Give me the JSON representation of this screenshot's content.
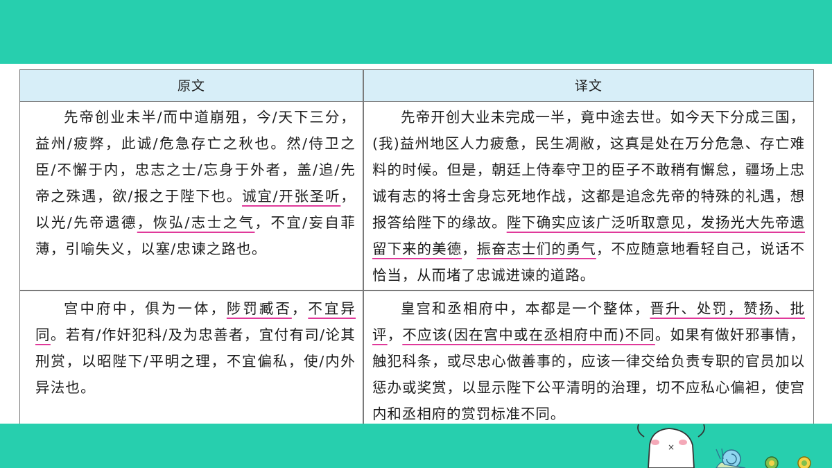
{
  "table": {
    "headers": [
      "原文",
      "译文"
    ],
    "rows": [
      {
        "original": [
          {
            "t": "先帝创业未半/而中道崩殂，今/天下三分，益州/疲弊，此诚/危急存亡之秋也。然/侍卫之臣/不懈于内，忠志之士/忘身于外者，盖/追/先帝之殊遇，欲/报之于陛下也。"
          },
          {
            "t": "诚宜/开张圣听",
            "hl": true
          },
          {
            "t": "，以光/先帝遗德",
            "hl": false
          },
          {
            "t": "，恢弘/志士之气",
            "hl": true
          },
          {
            "t": "，不宜/妄自菲薄，引喻失义，以塞/忠谏之路也。"
          }
        ],
        "translation": [
          {
            "t": "先帝开创大业未完成一半，竟中途去世。如今天下分成三国，(我)益州地区人力疲惫，民生凋敝，这真是处在万分危急、存亡难料的时候。但是，朝廷上侍奉守卫的臣子不敢稍有懈怠，疆场上忠诚有志的将士舍身忘死地作战，这都是追念先帝的特殊的礼遇，想报答给陛下的缘故。"
          },
          {
            "t": "陛下确实应该广泛听取意见",
            "hl": true
          },
          {
            "t": "，发扬光大先帝遗留下来的美德",
            "hl": true
          },
          {
            "t": "，"
          },
          {
            "t": "振奋志士们的勇气",
            "hl": true
          },
          {
            "t": "，不应随意地看轻自己，说话不恰当，从而堵了忠诚进谏的道路。"
          }
        ]
      },
      {
        "original": [
          {
            "t": "宫中府中，俱为一体，"
          },
          {
            "t": "陟罚臧否",
            "hl": true
          },
          {
            "t": "，"
          },
          {
            "t": "不宜异同",
            "hl": true
          },
          {
            "t": "。若有/作奸犯科/及为忠善者，宜付有司/论其刑赏，以昭陛下/平明之理，不宜偏私，使/内外异法也。"
          }
        ],
        "translation": [
          {
            "t": "皇宫和丞相府中，本都是一个整体，"
          },
          {
            "t": "晋升、处罚，赞扬、批评",
            "hl": true
          },
          {
            "t": "，"
          },
          {
            "t": "不应该(因在宫中或在丞相府中而)不同",
            "hl": true
          },
          {
            "t": "。如果有做奸邪事情，触犯科条，或尽忠心做善事的，应该一律交给负责专职的官员加以惩办或奖赏，以显示陛下公平清明的治理，切不应私心偏袒，使宫内和丞相府的赏罚标准不同。"
          }
        ]
      }
    ]
  },
  "colors": {
    "band": "#27cfae",
    "header_bg": "#d7eef8",
    "underline": "#e0399a"
  },
  "decor": {
    "mascot": "cartoon-dog-mascot",
    "snail": "snail-illustration"
  }
}
